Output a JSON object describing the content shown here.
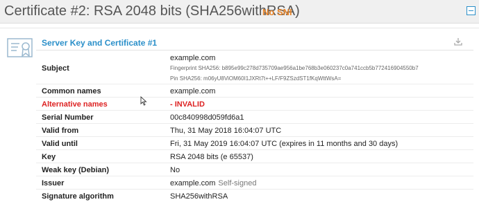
{
  "header": {
    "title": "Certificate #2: RSA 2048 bits (SHA256withRSA)",
    "badge": "No SNI"
  },
  "section": {
    "title": "Server Key and Certificate #1"
  },
  "subject": {
    "label": "Subject",
    "cn": "example.com",
    "fingerprint": "Fingerprint SHA256: b895e99c278d735709ae956a1be768b3e060237c0a741ccb5b772416904550b7",
    "pin": "Pin SHA256: m06yU8ViOM60I1JXRt7t++LF/F9ZSzdST1fKqWttWsA="
  },
  "rows": {
    "common_names": {
      "label": "Common names",
      "value": "example.com"
    },
    "alt_names": {
      "label": "Alternative names",
      "value": "-   INVALID"
    },
    "serial": {
      "label": "Serial Number",
      "value": "00c840998d059fd6a1"
    },
    "valid_from": {
      "label": "Valid from",
      "value": "Thu, 31 May 2018 16:04:07 UTC"
    },
    "valid_until": {
      "label": "Valid until",
      "value": "Fri, 31 May 2019 16:04:07 UTC (expires in 11 months and 30 days)"
    },
    "key": {
      "label": "Key",
      "value": "RSA 2048 bits (e 65537)"
    },
    "weak_key": {
      "label": "Weak key (Debian)",
      "value": "No"
    },
    "issuer": {
      "label": "Issuer",
      "value": "example.com",
      "note": "Self-signed"
    },
    "sig_alg": {
      "label": "Signature algorithm",
      "value": "SHA256withRSA"
    }
  },
  "colors": {
    "accent": "#2a8fc9",
    "warning": "#e8852a",
    "error": "#dd2222"
  }
}
